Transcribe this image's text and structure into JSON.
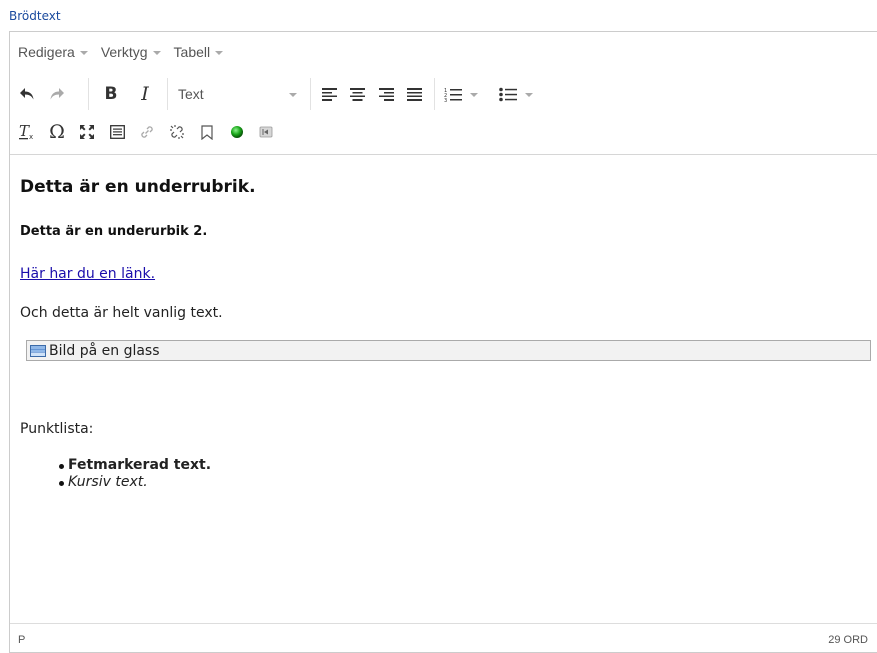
{
  "field": {
    "label": "Brödtext"
  },
  "menubar": [
    {
      "label": "Redigera"
    },
    {
      "label": "Verktyg"
    },
    {
      "label": "Tabell"
    }
  ],
  "toolbar": {
    "format_select": "Text",
    "icons": [
      "undo-icon",
      "redo-icon",
      "bold-icon",
      "italic-icon",
      "align-left-icon",
      "align-center-icon",
      "align-right-icon",
      "align-justify-icon",
      "numbered-list-icon",
      "bullet-list-icon",
      "clear-format-icon",
      "omega-icon",
      "fullscreen-icon",
      "image-icon",
      "link-icon",
      "unlink-icon",
      "bookmark-icon",
      "green-dot-icon",
      "embed-icon"
    ]
  },
  "content": {
    "heading2": "Detta är en underrubrik.",
    "heading3": "Detta är en underurbik 2.",
    "link": "Här har du en länk.",
    "paragraph1": "Och detta är helt vanlig text.",
    "image_placeholder": "Bild på en glass",
    "paragraph2": "Punktlista:",
    "list": [
      "Fetmarkerad text.",
      "Kursiv text."
    ]
  },
  "status": {
    "path": "P",
    "word_count": "29 ORD"
  },
  "colors": {
    "link": "#1a0dab",
    "label": "#1a4a9e",
    "green_dot": "#1aa81a"
  }
}
